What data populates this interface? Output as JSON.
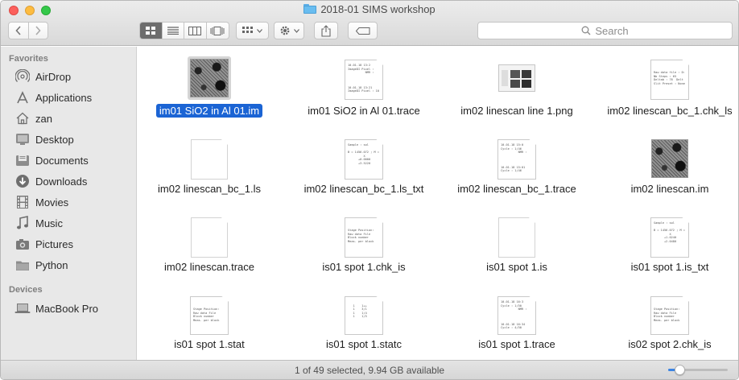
{
  "window": {
    "title": "2018-01 SIMS workshop"
  },
  "toolbar": {
    "back_icon": "chevron-left-icon",
    "forward_icon": "chevron-right-icon",
    "view_modes": [
      "icon-view",
      "list-view",
      "column-view",
      "cover-flow-view"
    ],
    "selected_view": "icon-view",
    "search_placeholder": "Search"
  },
  "sidebar": {
    "favorites_heading": "Favorites",
    "favorites": [
      {
        "label": "AirDrop",
        "icon": "airdrop-icon"
      },
      {
        "label": "Applications",
        "icon": "applications-icon"
      },
      {
        "label": "zan",
        "icon": "home-icon"
      },
      {
        "label": "Desktop",
        "icon": "desktop-icon"
      },
      {
        "label": "Documents",
        "icon": "documents-icon"
      },
      {
        "label": "Downloads",
        "icon": "downloads-icon"
      },
      {
        "label": "Movies",
        "icon": "movies-icon"
      },
      {
        "label": "Music",
        "icon": "music-icon"
      },
      {
        "label": "Pictures",
        "icon": "pictures-icon"
      },
      {
        "label": "Python",
        "icon": "folder-icon"
      }
    ],
    "devices_heading": "Devices",
    "devices": [
      {
        "label": "MacBook Pro",
        "icon": "laptop-icon"
      }
    ]
  },
  "files": [
    {
      "name": "im01 SiO2 in Al 01.im",
      "kind": "image",
      "selected": true
    },
    {
      "name": "im01 SiO2 in Al 01.trace",
      "kind": "text",
      "lines": "10.01.18 13:2\nImageDI Pixel :\n          NMR :\n\n\n\n10.01.18 13:21\nImageDI Pixel : 10"
    },
    {
      "name": "im02 linescan line 1.png",
      "kind": "screenshot"
    },
    {
      "name": "im02 linescan_bc_1.chk_ls",
      "kind": "text",
      "lines": "\n\nRaw data file : D:\nNb Steps : 65\nDeltab : 76  Delt\nSlit Preset : None"
    },
    {
      "name": "im02 linescan_bc_1.ls",
      "kind": "blank"
    },
    {
      "name": "im02 linescan_bc_1.ls_txt",
      "kind": "text",
      "lines": "Sample : sol\n\nB = 1456.072 ; M =\n         X\n      +0.0000\n      +3.5220"
    },
    {
      "name": "im02 linescan_bc_1.trace",
      "kind": "text",
      "lines": "10.01.18 15:0\nCycle : 1/46\n          NMR :\n\n\n\n10.01.18 15:01\nCycle : 1/46"
    },
    {
      "name": "im02 linescan.im",
      "kind": "image"
    },
    {
      "name": "im02 linescan.trace",
      "kind": "blank"
    },
    {
      "name": "is01 spot 1.chk_is",
      "kind": "text",
      "lines": "\n\nStage Position:\nRaw data File\nBlock number\nMeas. per block"
    },
    {
      "name": "is01 spot 1.is",
      "kind": "blank"
    },
    {
      "name": "is01 spot 1.is_txt",
      "kind": "text",
      "lines": "Sample : sol\n\nB = 1456.072 ; M =\n         X\n      +1.0240\n      +2.0480"
    },
    {
      "name": "is01 spot 1.stat",
      "kind": "text",
      "lines": "\n\nStage Position:\nRaw data File\nBlock number\nMeas. per block"
    },
    {
      "name": "is01 spot 1.statc",
      "kind": "text",
      "lines": "\n   1    1++\n   1    3/1\n   1    1/4\n   1    1/5"
    },
    {
      "name": "is01 spot 1.trace",
      "kind": "text",
      "lines": "10.01.18 16:3\nCycle : 1/50\n          NMR :\n\n\n\n10.01.18 16:34\nCycle : 4/50"
    },
    {
      "name": "is02 spot 2.chk_is",
      "kind": "text",
      "lines": "\n\nStage Position:\nRaw data File\nBlock number\nMeas. per block"
    }
  ],
  "status": {
    "text": "1 of 49 selected, 9.94 GB available",
    "icon_size_fraction": 0.2
  }
}
